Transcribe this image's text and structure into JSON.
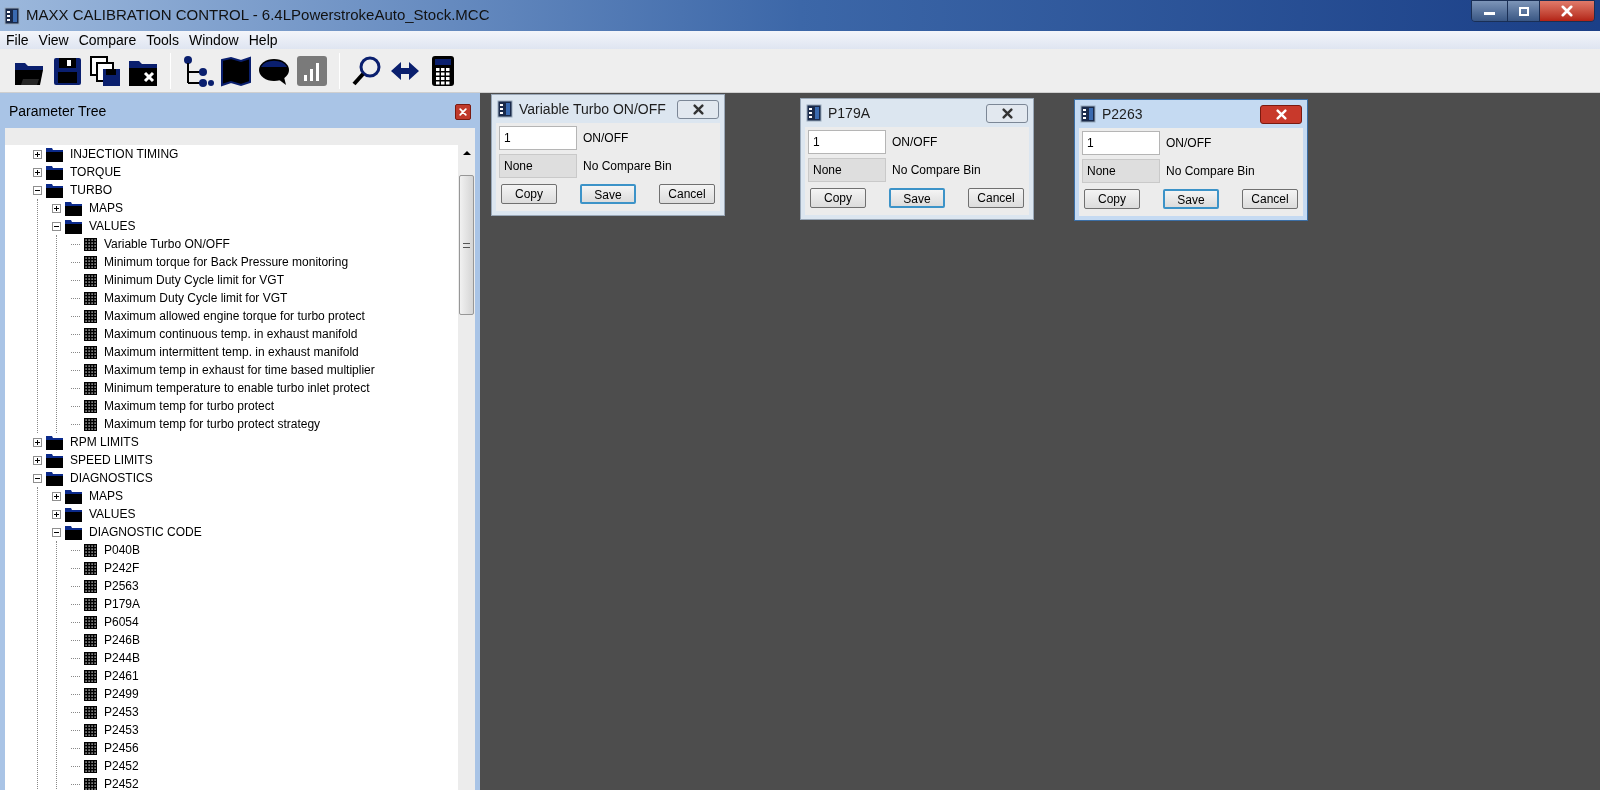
{
  "window": {
    "title": "MAXX CALIBRATION CONTROL - 6.4LPowerstrokeAuto_Stock.MCC"
  },
  "menu": [
    "File",
    "View",
    "Compare",
    "Tools",
    "Window",
    "Help"
  ],
  "toolbar": [
    {
      "kind": "open"
    },
    {
      "kind": "save"
    },
    {
      "kind": "copy"
    },
    {
      "kind": "close"
    },
    {
      "kind": "separator"
    },
    {
      "kind": "tree"
    },
    {
      "kind": "map"
    },
    {
      "kind": "bubble"
    },
    {
      "kind": "chart",
      "disabled": true
    },
    {
      "kind": "separator"
    },
    {
      "kind": "search"
    },
    {
      "kind": "arrows"
    },
    {
      "kind": "calculator"
    }
  ],
  "parameter_tree": {
    "title": "Parameter Tree",
    "items": [
      {
        "label": "INJECTION TIMING",
        "kind": "folder",
        "expanded": false
      },
      {
        "label": "TORQUE",
        "kind": "folder",
        "expanded": false
      },
      {
        "label": "TURBO",
        "kind": "folder",
        "expanded": true,
        "children": [
          {
            "label": "MAPS",
            "kind": "folder",
            "expanded": false
          },
          {
            "label": "VALUES",
            "kind": "folder",
            "expanded": true,
            "children": [
              {
                "label": "Variable Turbo ON/OFF",
                "kind": "parameter"
              },
              {
                "label": "Minimum torque for Back Pressure monitoring",
                "kind": "parameter"
              },
              {
                "label": "Minimum Duty Cycle limit for VGT",
                "kind": "parameter"
              },
              {
                "label": "Maximum Duty Cycle limit for VGT",
                "kind": "parameter"
              },
              {
                "label": "Maximum allowed engine torque for turbo protect",
                "kind": "parameter"
              },
              {
                "label": "Maximum continuous temp. in exhaust manifold",
                "kind": "parameter"
              },
              {
                "label": "Maximum intermittent temp. in exhaust manifold",
                "kind": "parameter"
              },
              {
                "label": "Maximum temp in exhaust for time based multiplier",
                "kind": "parameter"
              },
              {
                "label": "Minimum temperature to enable turbo inlet protect",
                "kind": "parameter"
              },
              {
                "label": "Maximum temp for turbo protect",
                "kind": "parameter"
              },
              {
                "label": "Maximum temp for turbo protect strategy",
                "kind": "parameter"
              }
            ]
          }
        ]
      },
      {
        "label": "RPM LIMITS",
        "kind": "folder",
        "expanded": false
      },
      {
        "label": "SPEED LIMITS",
        "kind": "folder",
        "expanded": false
      },
      {
        "label": "DIAGNOSTICS",
        "kind": "folder",
        "expanded": true,
        "children": [
          {
            "label": "MAPS",
            "kind": "folder",
            "expanded": false
          },
          {
            "label": "VALUES",
            "kind": "folder",
            "expanded": false
          },
          {
            "label": "DIAGNOSTIC CODE",
            "kind": "folder",
            "expanded": true,
            "children": [
              {
                "label": "P040B",
                "kind": "parameter"
              },
              {
                "label": "P242F",
                "kind": "parameter"
              },
              {
                "label": "P2563",
                "kind": "parameter"
              },
              {
                "label": "P179A",
                "kind": "parameter"
              },
              {
                "label": "P6054",
                "kind": "parameter"
              },
              {
                "label": "P246B",
                "kind": "parameter"
              },
              {
                "label": "P244B",
                "kind": "parameter"
              },
              {
                "label": "P2461",
                "kind": "parameter"
              },
              {
                "label": "P2499",
                "kind": "parameter"
              },
              {
                "label": "P2453",
                "kind": "parameter"
              },
              {
                "label": "P2453",
                "kind": "parameter"
              },
              {
                "label": "P2456",
                "kind": "parameter"
              },
              {
                "label": "P2452",
                "kind": "parameter"
              },
              {
                "label": "P2452",
                "kind": "parameter"
              }
            ]
          }
        ]
      }
    ]
  },
  "dialogs": [
    {
      "title": "Variable Turbo ON/OFF",
      "active": false,
      "value": "1",
      "value_label": "ON/OFF",
      "compare_value": "None",
      "compare_label": "No Compare Bin",
      "buttons": [
        {
          "label": "Copy",
          "default": false
        },
        {
          "label": "Save",
          "default": true
        },
        {
          "label": "Cancel",
          "default": false
        }
      ]
    },
    {
      "title": "P179A",
      "active": false,
      "value": "1",
      "value_label": "ON/OFF",
      "compare_value": "None",
      "compare_label": "No Compare Bin",
      "buttons": [
        {
          "label": "Copy",
          "default": false
        },
        {
          "label": "Save",
          "default": true
        },
        {
          "label": "Cancel",
          "default": false
        }
      ]
    },
    {
      "title": "P2263",
      "active": true,
      "value": "1",
      "value_label": "ON/OFF",
      "compare_value": "None",
      "compare_label": "No Compare Bin",
      "buttons": [
        {
          "label": "Copy",
          "default": false
        },
        {
          "label": "Save",
          "default": true
        },
        {
          "label": "Cancel",
          "default": false
        }
      ]
    }
  ]
}
